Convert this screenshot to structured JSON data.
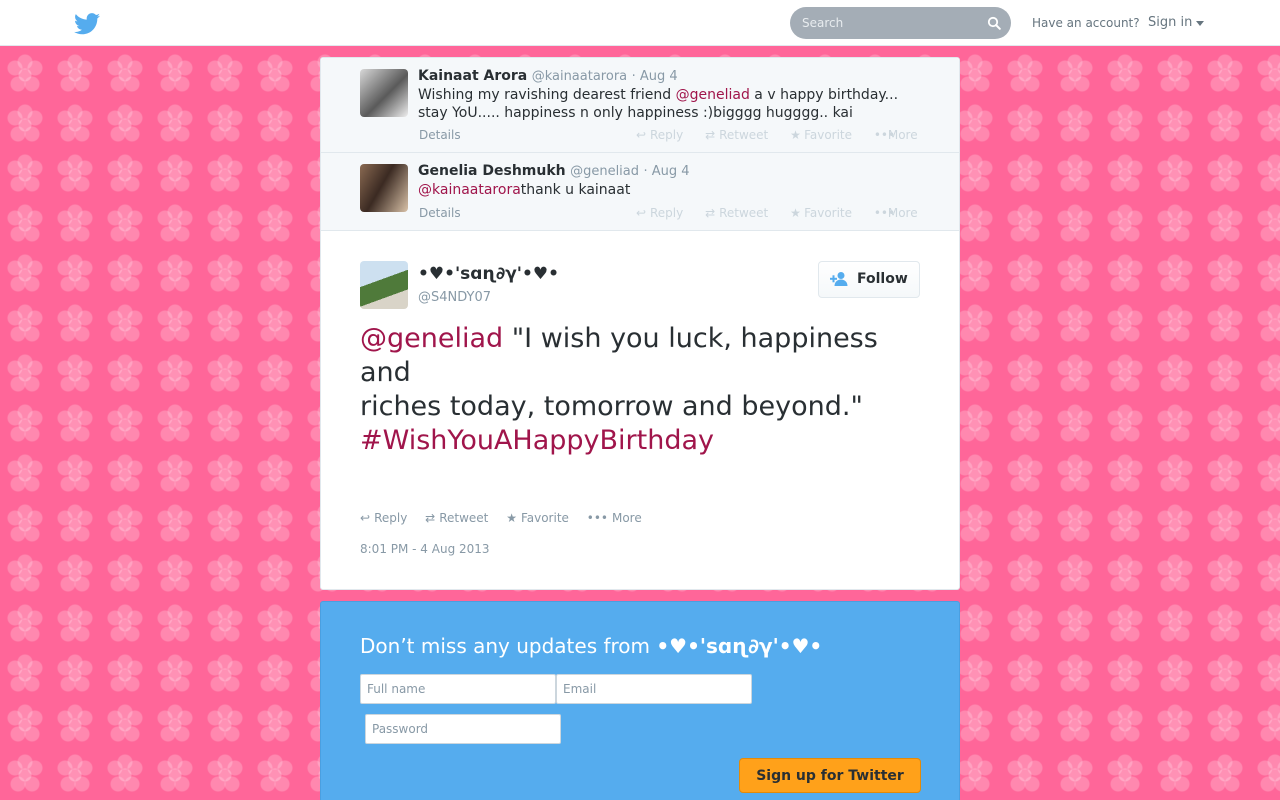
{
  "header": {
    "search_placeholder": "Search",
    "have_account": "Have an account?",
    "sign_in": "Sign in"
  },
  "ancestors": [
    {
      "fullname": "Kainaat Arora",
      "screenname": "@kainaatarora",
      "time": "· Aug 4",
      "text_before": "Wishing my ravishing dearest friend ",
      "mention": "@geneliad",
      "text_after": " a v happy birthday... stay YoU..... happiness n only happiness :)bigggg hugggg.. kai",
      "details": "Details"
    },
    {
      "fullname": "Genelia Deshmukh",
      "screenname": "@geneliad",
      "time": "· Aug 4",
      "text_before": "",
      "mention": "@kainaatarora",
      "text_after": "thank u kainaat",
      "details": "Details"
    }
  ],
  "actions": {
    "reply": "Reply",
    "retweet": "Retweet",
    "favorite": "Favorite",
    "more": "More"
  },
  "main_tweet": {
    "fullname": "•♥•'sɑɳ∂γ'•♥•",
    "screenname": "@S4NDY07",
    "follow": "Follow",
    "mention": "@geneliad",
    "line1": " \"I wish you luck, happiness and",
    "line2": "riches today, tomorrow and beyond.\"",
    "hashtag": "#WishYouAHappyBirthday",
    "timestamp": "8:01 PM - 4 Aug 2013"
  },
  "signup": {
    "title_prefix": "Don’t miss any updates from ",
    "title_name": "•♥•'sɑɳ∂γ'•♥•",
    "fullname_placeholder": "Full name",
    "email_placeholder": "Email",
    "password_placeholder": "Password",
    "button": "Sign up for Twitter"
  },
  "colors": {
    "background": "#ff6699",
    "link": "#a0154b",
    "signup_bg": "#55acee",
    "signup_button": "#ffa11a",
    "twitter_blue": "#55acee"
  },
  "icons": [
    "twitter-bird-icon",
    "search-icon",
    "caret-down-icon",
    "reply-icon",
    "retweet-icon",
    "favorite-star-icon",
    "more-dots-icon",
    "follow-person-icon"
  ]
}
